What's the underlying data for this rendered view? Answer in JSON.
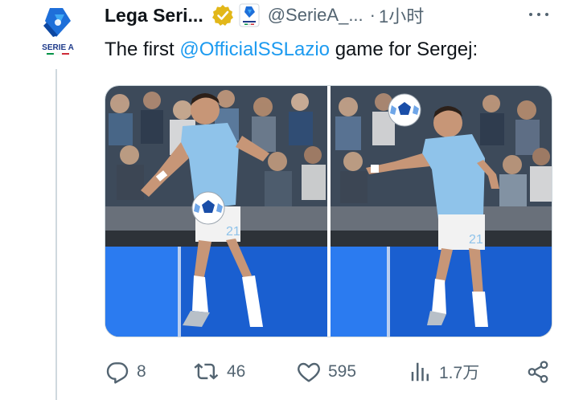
{
  "account": {
    "display_name": "Lega Seri...",
    "handle": "@SerieA_...",
    "separator": "·",
    "time": "1小时",
    "logo_text": "SERIE A"
  },
  "tweet": {
    "text_before": "The first ",
    "mention": "@OfficialSSLazio",
    "text_after": " game for Sergej:"
  },
  "media": {
    "photos": [
      {
        "alt": "Lazio player in light blue kit juggling the ball on his thigh, number 21"
      },
      {
        "alt": "Lazio player in light blue kit heading the ball, number 21"
      }
    ],
    "shirt_number": "21"
  },
  "actions": {
    "replies": "8",
    "reposts": "46",
    "likes": "595",
    "views": "1.7万"
  },
  "colors": {
    "accent": "#1d9bf0",
    "secondary_text": "#536471",
    "verified_gold": "#e2b719",
    "lazio_blue": "#8fc3ea",
    "serie_a_blue": "#1e6fd9"
  },
  "icons": {
    "more": "more-icon",
    "reply": "reply-icon",
    "repost": "repost-icon",
    "like": "like-icon",
    "views": "views-icon",
    "share": "share-icon",
    "verified": "verified-badge-icon",
    "affiliate": "affiliate-badge-icon"
  }
}
